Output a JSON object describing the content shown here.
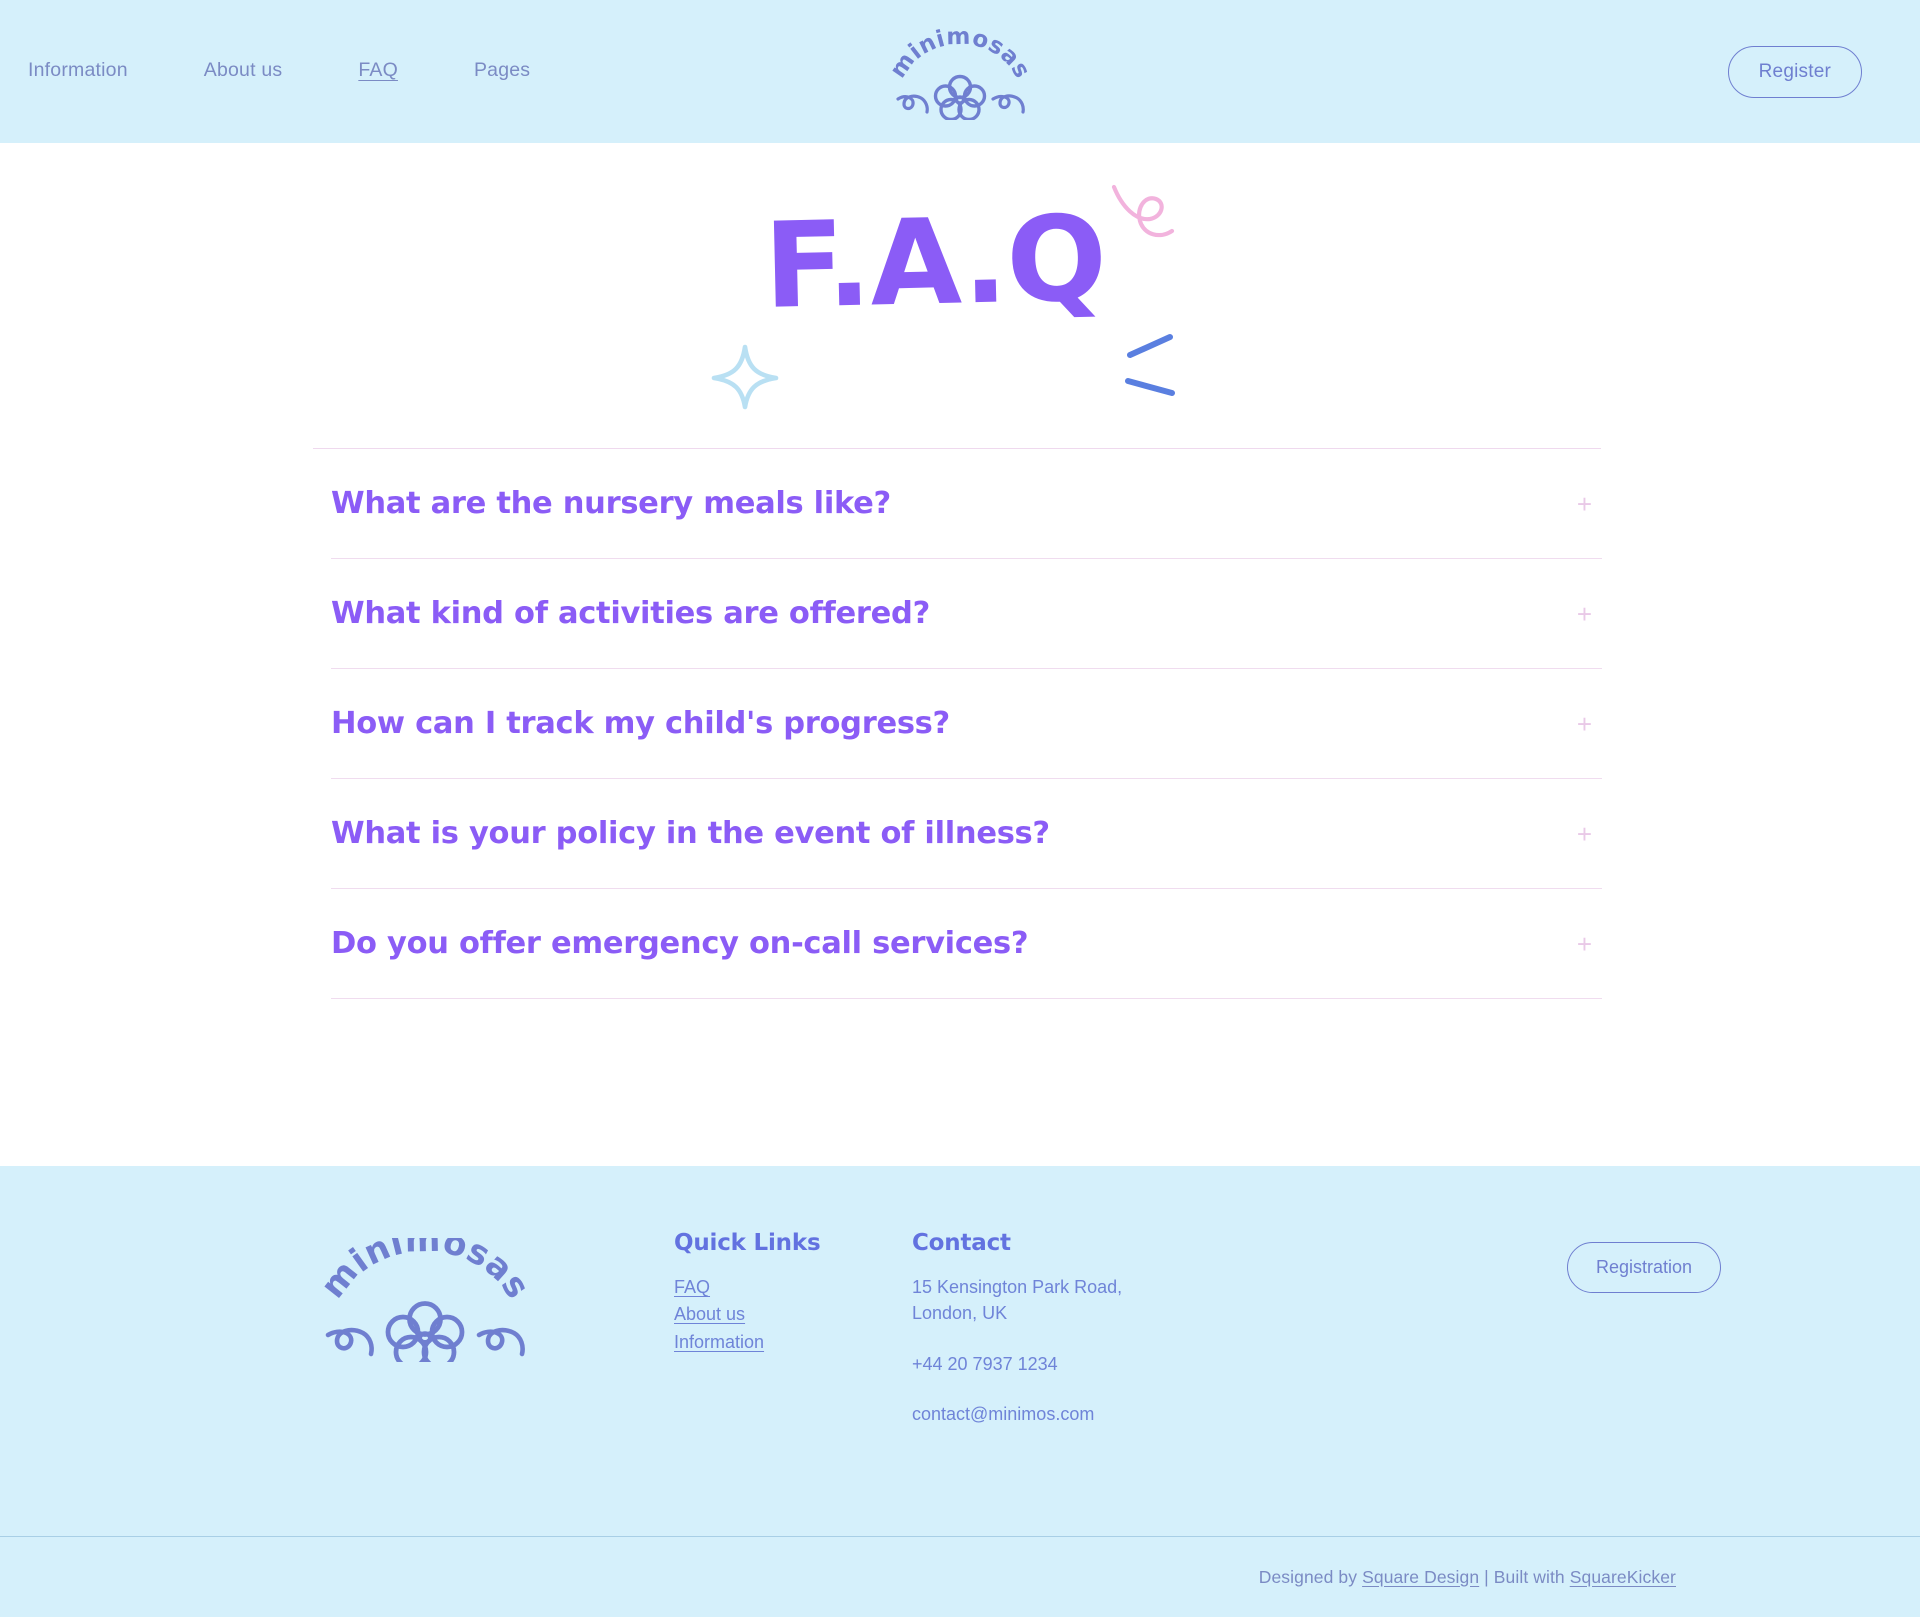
{
  "header": {
    "nav": [
      {
        "label": "Information",
        "active": false
      },
      {
        "label": "About us",
        "active": false
      },
      {
        "label": "FAQ",
        "active": true
      },
      {
        "label": "Pages",
        "active": false
      }
    ],
    "logo_text": "minimosas",
    "register_label": "Register"
  },
  "hero": {
    "title": "F.A.Q",
    "decorations": [
      "pink-squiggle-icon",
      "blue-sparkle-icon",
      "blue-dashes-icon"
    ]
  },
  "faq": {
    "expand_icon": "+",
    "items": [
      {
        "question": "What are the nursery meals like?"
      },
      {
        "question": "What kind of activities are offered?"
      },
      {
        "question": "How can I track my child's progress?"
      },
      {
        "question": "What is your policy in the event of illness?"
      },
      {
        "question": "Do you offer emergency on-call services?"
      }
    ]
  },
  "footer": {
    "logo_text": "minimosas",
    "quick_links": {
      "heading": "Quick Links",
      "links": [
        {
          "label": "FAQ"
        },
        {
          "label": "About us"
        },
        {
          "label": "Information"
        }
      ]
    },
    "contact": {
      "heading": "Contact",
      "address_line1": "15 Kensington Park Road,",
      "address_line2": "London, UK",
      "phone": "+44 20 7937 1234",
      "email": "contact@minimos.com"
    },
    "registration_label": "Registration",
    "credit": {
      "prefix": "Designed by ",
      "designer": "Square Design",
      "middle": " | Built with ",
      "builder": "SquareKicker"
    }
  },
  "colors": {
    "header_bg": "#d5f0fb",
    "footer_bg": "#d5f0fb",
    "purple": "#8b5cf6",
    "nav_text": "#7b8bc4",
    "logo_blue": "#6f7fd0",
    "rule_pink": "#f0dcef",
    "pink_squiggle": "#f4b8dd",
    "blue_sparkle": "#bfe3f5",
    "blue_dash": "#5a7fe0"
  }
}
